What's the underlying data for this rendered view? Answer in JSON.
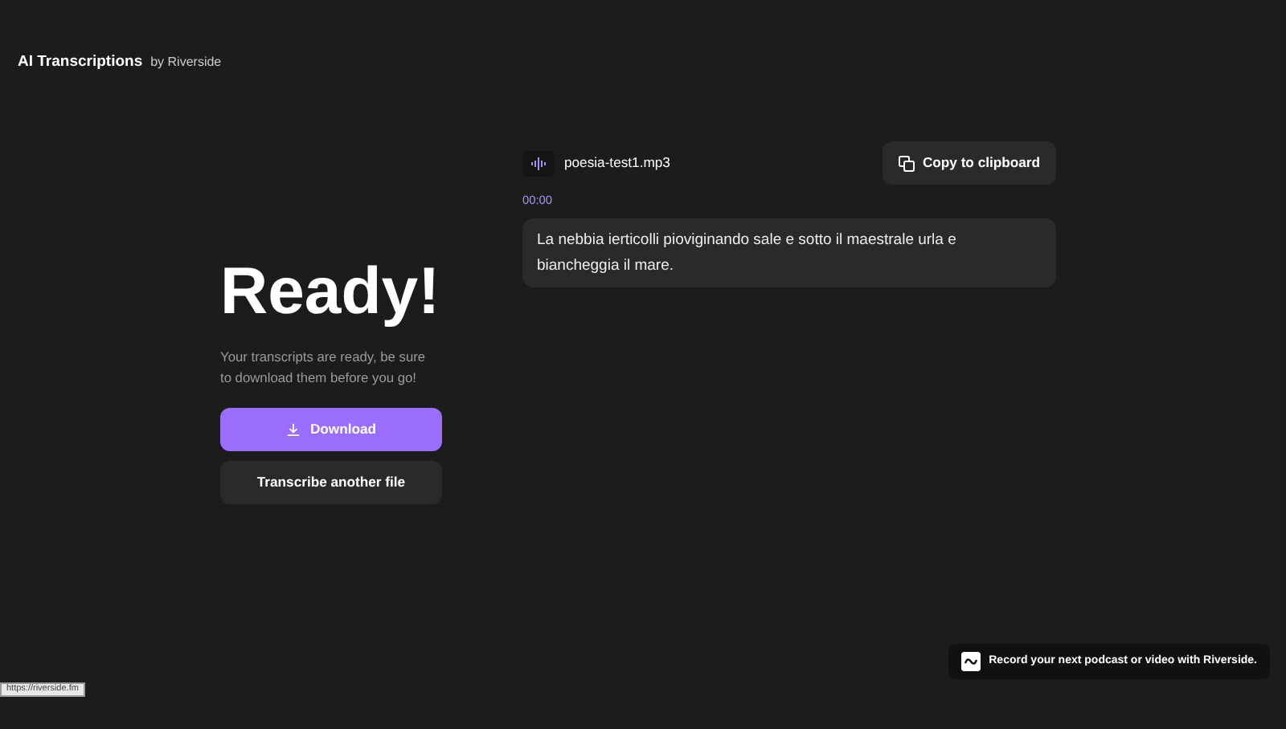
{
  "header": {
    "title": "AI Transcriptions",
    "byline": "by Riverside"
  },
  "ready": {
    "heading": "Ready!",
    "message": "Your transcripts are ready, be sure to download them before you go!",
    "buttons": [
      {
        "label": "Download",
        "kind": "primary"
      },
      {
        "label": "Transcribe another file",
        "kind": "secondary"
      }
    ]
  },
  "transcript": {
    "file_name": "poesia-test1.mp3",
    "copy_button": "Copy to clipboard",
    "timestamp": "00:00",
    "text": "La nebbia ierticolli pioviginando sale e sotto il maestrale urla e biancheggia il mare."
  },
  "promo": {
    "text": "Record your next podcast or video with Riverside."
  },
  "status_url": "https://riverside.fm"
}
